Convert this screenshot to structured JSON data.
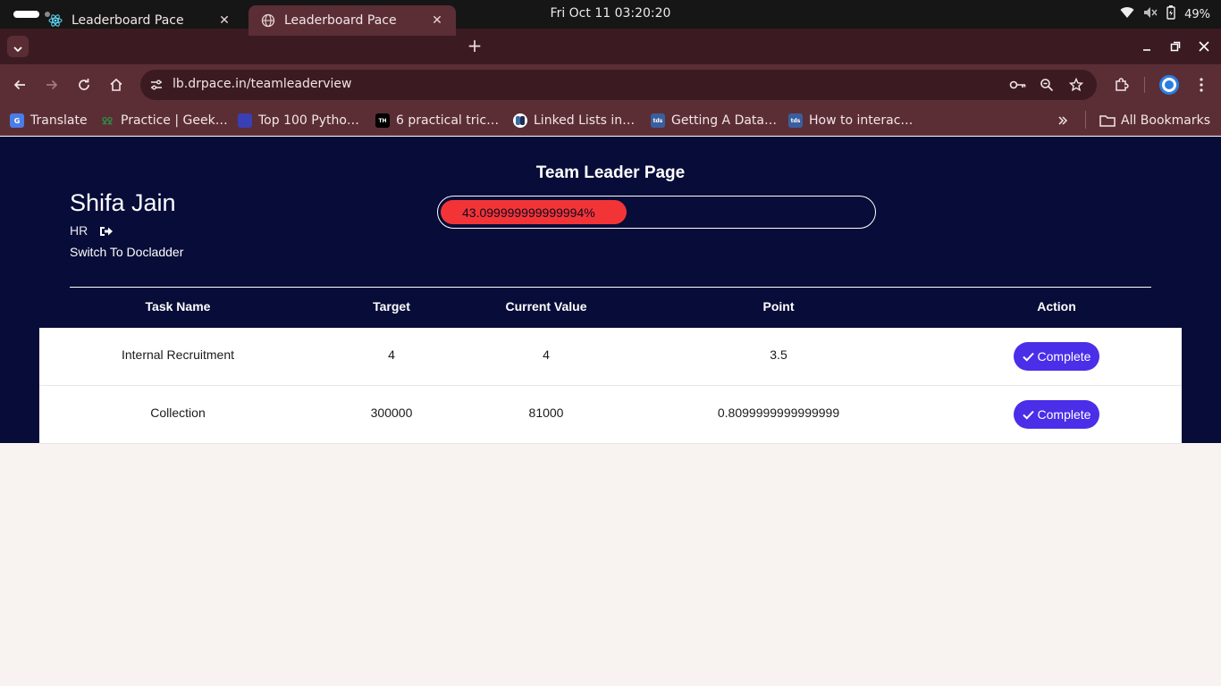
{
  "os": {
    "clock": "Fri Oct 11  03:20:20",
    "battery": "49%"
  },
  "browser": {
    "tabs": [
      {
        "label": "Leaderboard Pace",
        "favicon": "react-icon"
      },
      {
        "label": "Leaderboard Pace",
        "favicon": "globe-icon"
      }
    ],
    "url": "lb.drpace.in/teamleaderview",
    "bookmarks": [
      {
        "label": "Translate",
        "icon": "google-translate-icon",
        "color": "#4a7de8"
      },
      {
        "label": "Practice | Geek…",
        "icon": "geeksforgeeks-icon",
        "color": "#2f8d46"
      },
      {
        "label": "Top 100 Pytho…",
        "icon": "site-icon",
        "color": "#3b3fb6"
      },
      {
        "label": "6 practical tric…",
        "icon": "site-icon",
        "color": "#000000"
      },
      {
        "label": "Linked Lists in…",
        "icon": "python-icon",
        "color": "#ffffff"
      },
      {
        "label": "Getting A Data…",
        "icon": "tds-icon",
        "color": "#3a5f9e"
      },
      {
        "label": "How to interac…",
        "icon": "tds-icon",
        "color": "#3a5f9e"
      }
    ],
    "all_bookmarks": "All Bookmarks"
  },
  "page": {
    "title": "Team Leader Page",
    "user": {
      "name": "Shifa Jain",
      "role": "HR"
    },
    "switch_link": "Switch To Docladder",
    "progress": {
      "percent": 43.099999999999994,
      "label": "43.099999999999994%"
    },
    "table": {
      "headers": [
        "Task Name",
        "Target",
        "Current Value",
        "Point",
        "Action"
      ],
      "rows": [
        {
          "task": "Internal Recruitment",
          "target": "4",
          "current": "4",
          "point": "3.5",
          "action": "Complete"
        },
        {
          "task": "Collection",
          "target": "300000",
          "current": "81000",
          "point": "0.8099999999999999",
          "action": "Complete"
        }
      ]
    }
  },
  "colors": {
    "page_bg": "#070c38",
    "progress_fill": "#f33437",
    "button": "#4a2ee8",
    "chrome_dark": "#3b1b21",
    "chrome": "#5b2e36"
  }
}
